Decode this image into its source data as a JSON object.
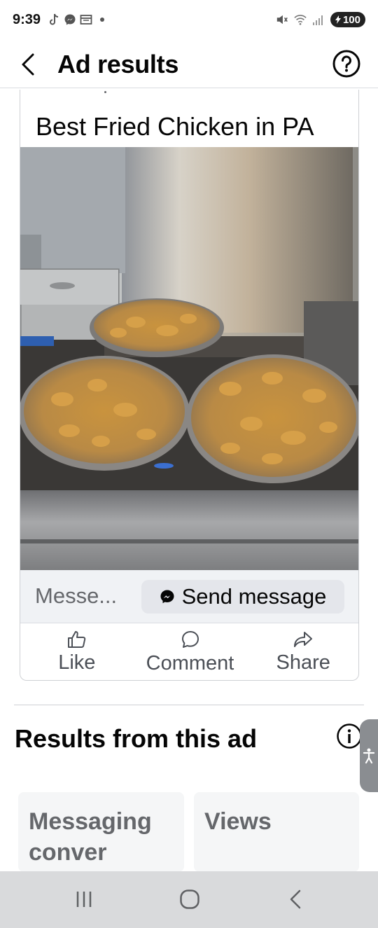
{
  "status_bar": {
    "time": "9:39",
    "notification_icons": [
      "tiktok-icon",
      "messenger-icon",
      "calendar-icon",
      "dot-icon"
    ],
    "system_icons": [
      "mute-icon",
      "wifi-icon",
      "signal-icon"
    ],
    "battery": "100"
  },
  "app_bar": {
    "title": "Ad results",
    "back_icon": "chevron-left-icon",
    "help_icon": "question-circle-icon"
  },
  "ad_card": {
    "caption": "Best Fried Chicken in PA",
    "image_alt": "Fried chicken in three pans on a stove",
    "message_placeholder": "Messe...",
    "send_button": "Send message",
    "actions": [
      {
        "label": "Like",
        "icon": "thumbs-up-icon"
      },
      {
        "label": "Comment",
        "icon": "comment-icon"
      },
      {
        "label": "Share",
        "icon": "share-icon"
      }
    ]
  },
  "results_section": {
    "title": "Results from this ad",
    "tiles": [
      {
        "label": "Messaging conver"
      },
      {
        "label": "Views"
      }
    ]
  },
  "colors": {
    "text_primary": "#050505",
    "text_secondary": "#65676b",
    "button_bg": "#e4e6eb",
    "nav_bar_bg": "#d9dadc"
  }
}
